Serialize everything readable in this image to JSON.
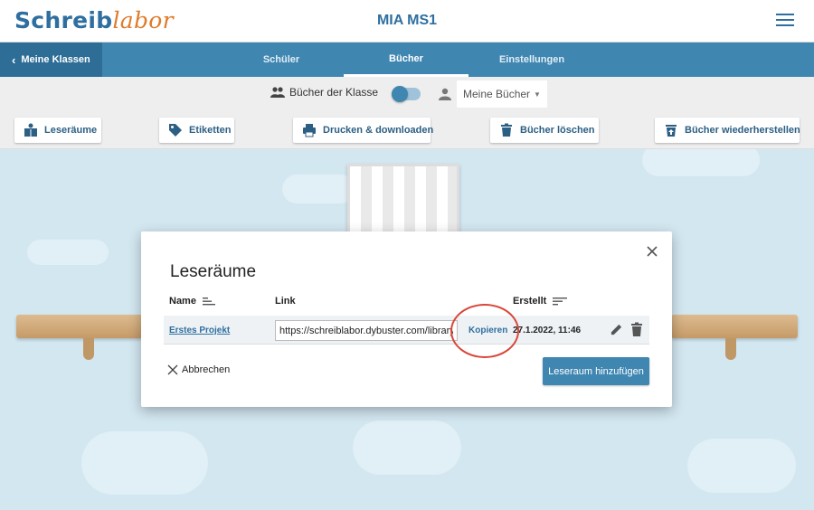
{
  "header": {
    "logo_part1": "Schreib",
    "logo_part2": "labor",
    "title": "MIA MS1"
  },
  "nav": {
    "back_label": "Meine Klassen",
    "tabs": [
      {
        "label": "Schüler",
        "active": false
      },
      {
        "label": "Bücher",
        "active": true
      },
      {
        "label": "Einstellungen",
        "active": false
      }
    ]
  },
  "filter": {
    "class_books_label": "Bücher der Klasse",
    "my_books_label": "Meine Bücher"
  },
  "toolbar": {
    "buttons": [
      {
        "label": "Leseräume",
        "icon": "reading-room-icon"
      },
      {
        "label": "Etiketten",
        "icon": "tag-icon"
      },
      {
        "label": "Drucken & downloaden",
        "icon": "print-icon"
      },
      {
        "label": "Bücher löschen",
        "icon": "trash-icon"
      },
      {
        "label": "Bücher wiederherstellen",
        "icon": "restore-icon"
      }
    ]
  },
  "dialog": {
    "title": "Leseräume",
    "columns": {
      "name": "Name",
      "link": "Link",
      "created": "Erstellt"
    },
    "rows": [
      {
        "name": "Erstes Projekt",
        "link": "https://schreiblabor.dybuster.com/library",
        "copy_label": "Kopieren",
        "created": "27.1.2022, 11:46"
      }
    ],
    "cancel_label": "Abbrechen",
    "add_label": "Leseraum hinzufügen"
  },
  "colors": {
    "primary": "#3f86b1",
    "primary_dark": "#2d6d96",
    "logo_orange": "#e07b2a",
    "highlight_circle": "#d9473b"
  }
}
